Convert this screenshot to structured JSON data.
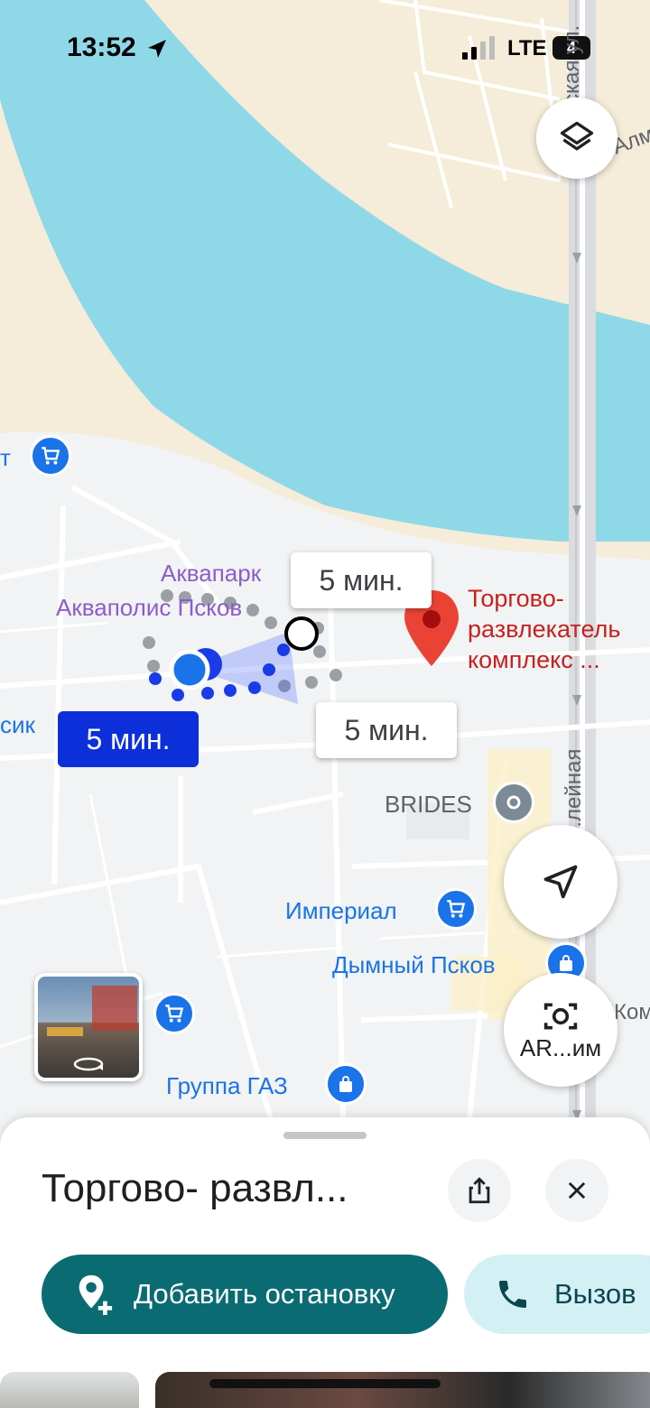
{
  "status_bar": {
    "time": "13:52",
    "network": "LTE",
    "battery": "4"
  },
  "map": {
    "colors": {
      "water": "#8fd8e8",
      "sand": "#f5ecd9",
      "land": "#f1f3f4",
      "road": "#ffffff",
      "highway": "#dadce0",
      "route_blue": "#1a3be8"
    },
    "street_labels": {
      "top_right": "...дская ул.",
      "far_right": "Алма",
      "alley": "...лейная"
    },
    "pois": {
      "aquapark": "Аквапарк",
      "aquapolis": "Акваполис Псков",
      "brides": "BRIDES",
      "imperial": "Империал",
      "dymny": "Дымный Псков",
      "gaz": "Группа ГАЗ",
      "left_partial_1": "т",
      "left_partial_2": "сик",
      "right_partial": "Ком"
    },
    "destination": {
      "line1": "Торгово-",
      "line2": "развлекатель",
      "line3": "комплекс ..."
    },
    "eta_bubbles": {
      "top": "5 мин.",
      "bottom": "5 мин.",
      "selected": "5 мин."
    },
    "buttons": {
      "layers": "layers-icon",
      "locate": "navigation-arrow-icon",
      "ar_label": "AR...им"
    }
  },
  "sheet": {
    "title": "Торгово- развл...",
    "share": "share-icon",
    "close": "close-icon",
    "add_stop_label": "Добавить остановку",
    "call_label": "Вызов"
  }
}
